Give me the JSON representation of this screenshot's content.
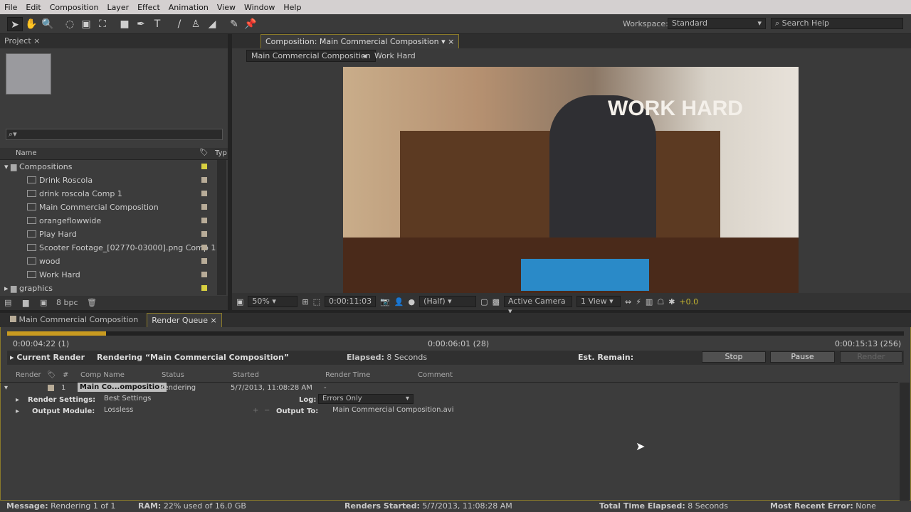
{
  "menu": [
    "File",
    "Edit",
    "Composition",
    "Layer",
    "Effect",
    "Animation",
    "View",
    "Window",
    "Help"
  ],
  "toolbar": {
    "tools": [
      "selection-tool",
      "hand-tool",
      "zoom-tool",
      "rotate-tool",
      "camera-tool",
      "pan-behind-tool",
      "rectangle-tool",
      "pen-tool",
      "type-tool",
      "brush-tool",
      "clone-stamp-tool",
      "eraser-tool",
      "roto-brush-tool",
      "puppet-pin-tool"
    ],
    "workspace_label": "Workspace:",
    "workspace_value": "Standard",
    "search_placeholder": "Search Help"
  },
  "project": {
    "tab": "Project",
    "col_name": "Name",
    "col_type": "Typ",
    "bpc": "8 bpc",
    "items": [
      {
        "label": "Compositions",
        "type": "folder",
        "color": "#d8d040"
      },
      {
        "label": "Drink Roscola",
        "type": "comp",
        "color": "#b8ac98"
      },
      {
        "label": "drink roscola Comp 1",
        "type": "comp",
        "color": "#b8ac98"
      },
      {
        "label": "Main Commercial Composition",
        "type": "comp",
        "color": "#b8ac98"
      },
      {
        "label": "orangeflowwide",
        "type": "comp",
        "color": "#b8ac98"
      },
      {
        "label": "Play Hard",
        "type": "comp",
        "color": "#b8ac98"
      },
      {
        "label": "Scooter Footage_[02770-03000].png Comp 1",
        "type": "comp",
        "color": "#b8ac98"
      },
      {
        "label": "wood",
        "type": "comp",
        "color": "#b8ac98"
      },
      {
        "label": "Work Hard",
        "type": "comp",
        "color": "#b8ac98"
      },
      {
        "label": "graphics",
        "type": "folder",
        "color": "#d8d040"
      }
    ]
  },
  "composition": {
    "tab": "Composition: Main Commercial Composition",
    "breadcrumbs": [
      "Main Commercial Composition",
      "Work Hard"
    ],
    "overlay_text": "WORK HARD",
    "zoom": "50%",
    "timecode": "0:00:11:03",
    "resolution": "(Half)",
    "camera": "Active Camera",
    "views": "1 View",
    "exposure": "+0.0"
  },
  "render_queue": {
    "tabs": [
      "Main Commercial Composition",
      "Render Queue"
    ],
    "progress_percent": 11,
    "start_time": "0:00:04:22 (1)",
    "current_time": "0:00:06:01 (28)",
    "end_time": "0:00:15:13 (256)",
    "current_render_label": "Current Render",
    "rendering_text": "Rendering “Main Commercial Composition”",
    "elapsed_label": "Elapsed:",
    "elapsed_value": "8 Seconds",
    "est_remain_label": "Est. Remain:",
    "stop": "Stop",
    "pause": "Pause",
    "render": "Render",
    "columns": [
      "Render",
      "#",
      "Comp Name",
      "Status",
      "Started",
      "Render Time",
      "Comment"
    ],
    "item": {
      "number": "1",
      "comp_name": "Main Co...omposition",
      "status": "Rendering",
      "started": "5/7/2013, 11:08:28 AM",
      "render_time": "-",
      "render_settings_label": "Render Settings:",
      "render_settings": "Best Settings",
      "log_label": "Log:",
      "log": "Errors Only",
      "output_module_label": "Output Module:",
      "output_module": "Lossless",
      "output_to_label": "Output To:",
      "output_to": "Main Commercial Composition.avi"
    }
  },
  "status": {
    "message_label": "Message:",
    "message": "Rendering 1 of 1",
    "ram_label": "RAM:",
    "ram": "22% used of 16.0 GB",
    "renders_started_label": "Renders Started:",
    "renders_started": "5/7/2013, 11:08:28 AM",
    "total_label": "Total Time Elapsed:",
    "total": "8 Seconds",
    "error_label": "Most Recent Error:",
    "error": "None"
  }
}
